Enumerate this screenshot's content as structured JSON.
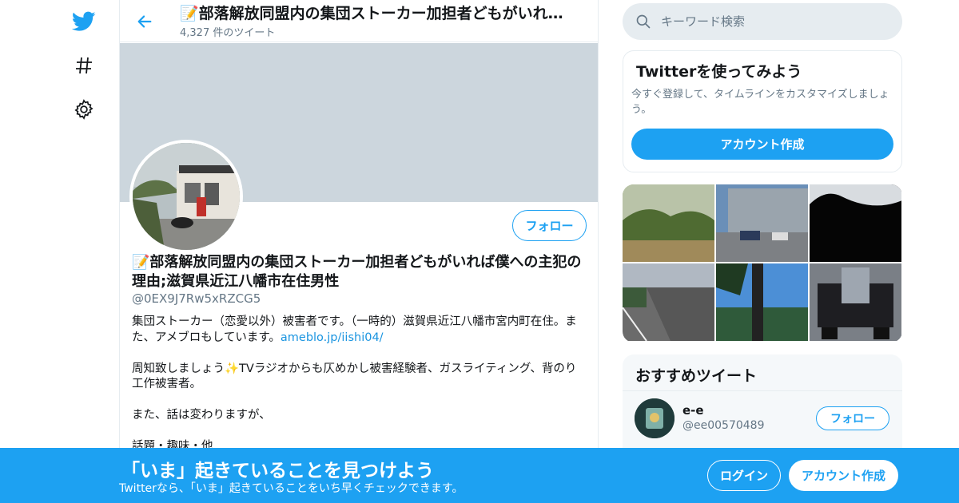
{
  "colors": {
    "brand": "#1da1f2",
    "text": "#14171a",
    "muted": "#657786",
    "banner": "#ccd6dd"
  },
  "nav": {
    "icons": [
      "twitter-bird-icon",
      "hashtag-icon",
      "gear-icon"
    ]
  },
  "header": {
    "title": "📝部落解放同盟内の集団ストーカー加担者どもがいれば僕への主犯の理由;滋賀県近江八幡市在住男性",
    "tweet_count": "4,327 件のツイート"
  },
  "profile": {
    "follow_label": "フォロー",
    "name": "📝部落解放同盟内の集団ストーカー加担者どもがいれば僕への主犯の理由;滋賀県近江八幡市在住男性",
    "handle": "@0EX9J7Rw5xRZCG5",
    "bio_line1": "集団ストーカー（恋愛以外）被害者です。（一時的）滋賀県近江八幡市宮内町在住。また、アメブロもしています。",
    "bio_link": "ameblo.jp/iishi04/",
    "bio_line2": "周知致しましょう✨TVラジオからも仄めかし被害経験者、ガスライティング、背のり工作被害者。",
    "bio_line3": "また、話は変わりますが、",
    "bio_line4": "話題・趣味・他"
  },
  "search": {
    "placeholder": "キーワード検索"
  },
  "signup_card": {
    "title": "Twitterを使ってみよう",
    "description": "今すぐ登録して、タイムラインをカスタマイズしましょう。",
    "button_label": "アカウント作成"
  },
  "recommended": {
    "title": "おすすめツイート",
    "user": {
      "name": "e-e",
      "handle": "@ee00570489",
      "follow_label": "フォロー"
    }
  },
  "bottom_bar": {
    "title": "「いま」起きていることを見つけよう",
    "subtitle": "Twitterなら、「いま」起きていることをいち早くチェックできます。",
    "login_label": "ログイン",
    "signup_label": "アカウント作成"
  }
}
